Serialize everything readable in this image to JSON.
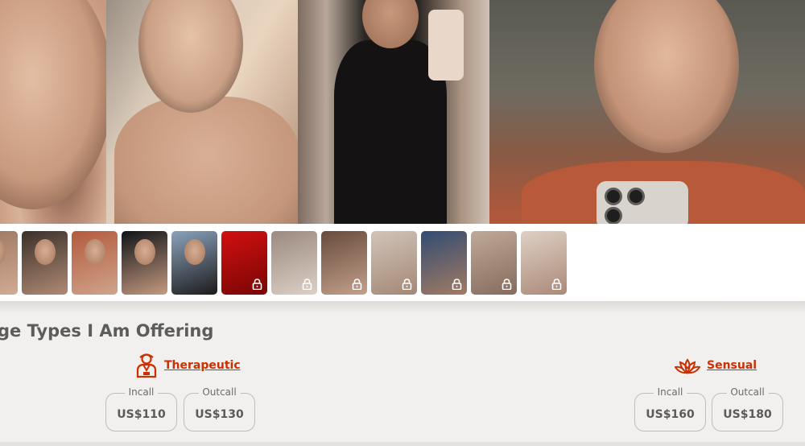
{
  "gallery": {
    "hero_photos": [
      "profile-photo-1",
      "profile-photo-2",
      "profile-photo-3",
      "profile-photo-4"
    ],
    "thumbnails": [
      {
        "kind": "photo",
        "locked": false,
        "tone": [
          "#9c7560",
          "#d2ab93"
        ]
      },
      {
        "kind": "photo",
        "locked": false,
        "tone": [
          "#3a302a",
          "#b08a74"
        ]
      },
      {
        "kind": "photo",
        "locked": false,
        "tone": [
          "#b35a3c",
          "#cfa48c"
        ]
      },
      {
        "kind": "photo",
        "locked": false,
        "tone": [
          "#0f1318",
          "#c69a80"
        ]
      },
      {
        "kind": "photo",
        "locked": false,
        "tone": [
          "#8aa3bd",
          "#1c1a1a"
        ]
      },
      {
        "kind": "photo",
        "locked": true,
        "tone": [
          "#d11010",
          "#7a0505"
        ]
      },
      {
        "kind": "photo",
        "locked": true,
        "tone": [
          "#9c8a7e",
          "#e0d0c4"
        ]
      },
      {
        "kind": "photo",
        "locked": true,
        "tone": [
          "#6b4a38",
          "#c8a088"
        ]
      },
      {
        "kind": "photo",
        "locked": true,
        "tone": [
          "#d3c3b6",
          "#a88670"
        ]
      },
      {
        "kind": "photo",
        "locked": true,
        "tone": [
          "#2e4c7a",
          "#a87a5e"
        ]
      },
      {
        "kind": "photo",
        "locked": true,
        "tone": [
          "#c2a896",
          "#8a6a58"
        ]
      },
      {
        "kind": "photo",
        "locked": true,
        "tone": [
          "#e0cfc2",
          "#b08874"
        ]
      }
    ]
  },
  "massage": {
    "title": "ge Types I Am Offering",
    "types": [
      {
        "name": "Therapeutic",
        "icon": "therapist-icon",
        "incall_label": "Incall",
        "incall": "US$110",
        "outcall_label": "Outcall",
        "outcall": "US$130"
      },
      {
        "name": "Sensual",
        "icon": "lotus-icon",
        "incall_label": "Incall",
        "incall": "US$160",
        "outcall_label": "Outcall",
        "outcall": "US$180"
      }
    ]
  },
  "colors": {
    "accent": "#cc2f00",
    "locked_red": "#d11010",
    "background": "#f1f0ee"
  }
}
